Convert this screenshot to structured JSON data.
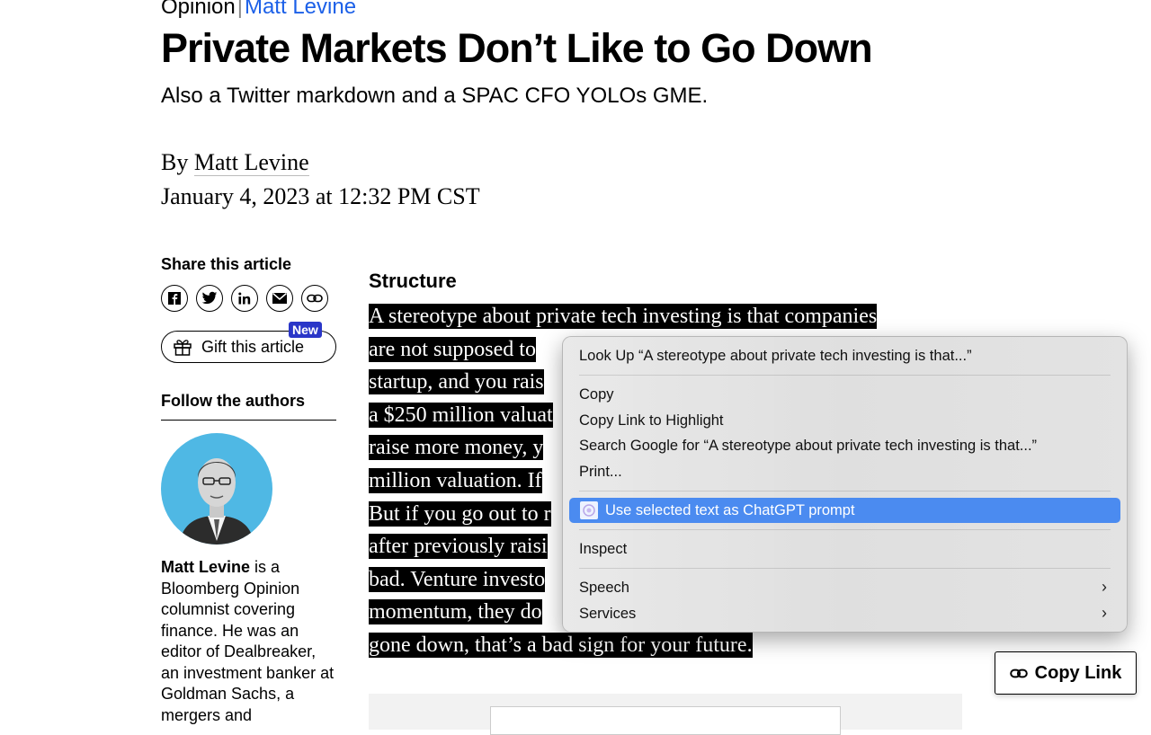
{
  "article": {
    "section": "Opinion",
    "author_link": "Matt Levine",
    "headline": "Private Markets Don’t Like to Go Down",
    "dek": "Also a Twitter markdown and a SPAC CFO YOLOs GME.",
    "byline_prefix": "By",
    "byline_name": "Matt Levine",
    "date": "January 4, 2023 at 12:32 PM CST",
    "section_heading": "Structure",
    "lines": [
      "A stereotype about private tech investing is that companies",
      "are not supposed to",
      "startup, and you rais",
      "a $250 million valuat",
      "raise more money, y",
      "million valuation. If",
      "But if you go out to r",
      "after previously raisi",
      "bad. Venture investo",
      "momentum, they do",
      "gone down, that’s a bad sign for your future."
    ]
  },
  "sidebar": {
    "share_title": "Share this article",
    "share_icons": [
      "facebook-icon",
      "twitter-icon",
      "linkedin-icon",
      "email-icon",
      "link-icon"
    ],
    "gift_label": "Gift this article",
    "new_badge": "New",
    "follow_title": "Follow the authors",
    "bio_name": "Matt Levine",
    "bio_text": " is a Bloomberg Opinion columnist covering finance. He was an editor of Dealbreaker, an investment banker at Goldman Sachs, a mergers and"
  },
  "copy_link_label": "Copy Link",
  "context_menu": {
    "look_up": "Look Up “A stereotype about private tech investing is that...”",
    "copy": "Copy",
    "copy_link_highlight": "Copy Link to Highlight",
    "search_google": "Search Google for “A stereotype about private tech investing is that...”",
    "print": "Print...",
    "chatgpt": "Use selected text as ChatGPT prompt",
    "inspect": "Inspect",
    "speech": "Speech",
    "services": "Services"
  },
  "colors": {
    "link": "#1c60e8",
    "highlight": "#4b8bf0",
    "badge": "#2a36c8",
    "avatar_bg": "#4fb8e4"
  }
}
